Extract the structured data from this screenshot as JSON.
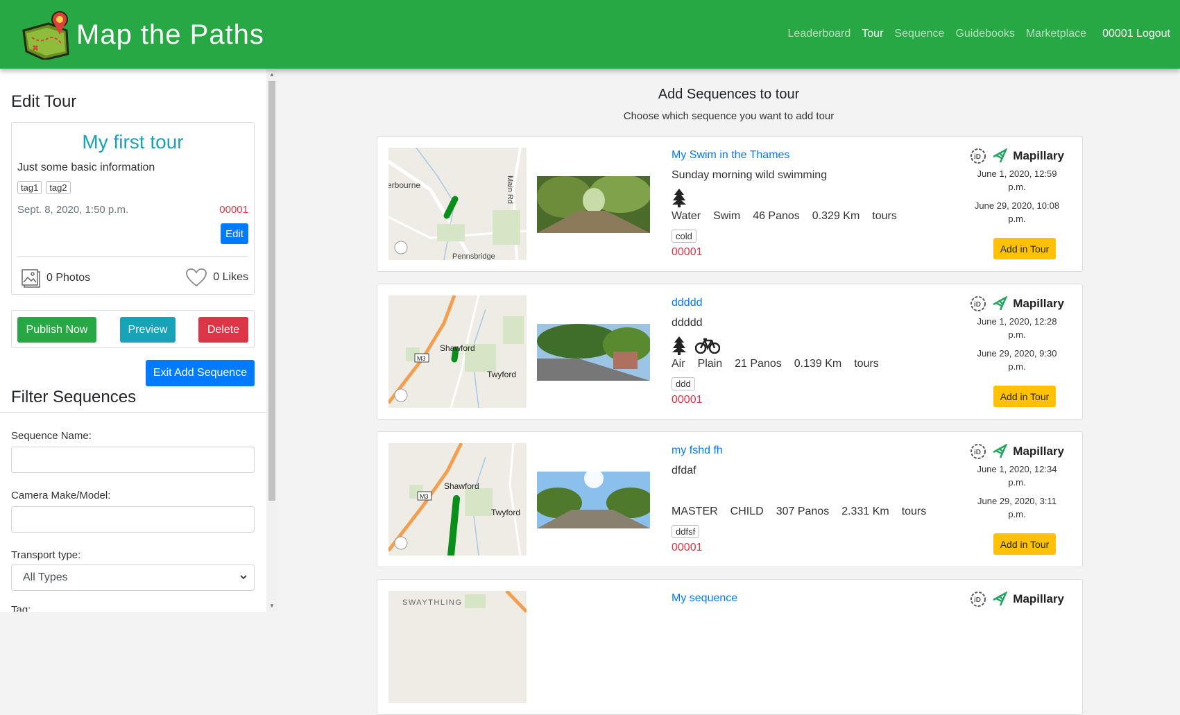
{
  "brand": {
    "name": "Map the Paths"
  },
  "nav": {
    "links": [
      {
        "label": "Leaderboard",
        "active": false
      },
      {
        "label": "Tour",
        "active": true
      },
      {
        "label": "Sequence",
        "active": false
      },
      {
        "label": "Guidebooks",
        "active": false
      },
      {
        "label": "Marketplace",
        "active": false
      }
    ],
    "user_logout": "00001 Logout"
  },
  "sidebar": {
    "title": "Edit Tour",
    "tour": {
      "name": "My first tour",
      "description": "Just some basic information",
      "tags": [
        "tag1",
        "tag2"
      ],
      "date": "Sept. 8, 2020, 1:50 p.m.",
      "user": "00001",
      "edit_label": "Edit",
      "photos": "0 Photos",
      "likes": "0 Likes"
    },
    "actions": {
      "publish": "Publish Now",
      "preview": "Preview",
      "delete": "Delete"
    },
    "exit_label": "Exit Add Sequence",
    "filter": {
      "title": "Filter Sequences",
      "sequence_name_label": "Sequence Name:",
      "sequence_name_value": "",
      "camera_label": "Camera Make/Model:",
      "camera_value": "",
      "transport_label": "Transport type:",
      "transport_value": "All Types",
      "tag_label": "Tag:"
    }
  },
  "main": {
    "title": "Add Sequences to tour",
    "subtitle": "Choose which sequence you want to add tour",
    "add_label": "Add in Tour",
    "mapillary_label": "Mapillary",
    "sequences": [
      {
        "title": "My Swim in the Thames",
        "description": "Sunday morning wild swimming",
        "icons": [
          "tree-icon"
        ],
        "stats": [
          "Water",
          "Swim",
          "46 Panos",
          "0.329 Km",
          "tours"
        ],
        "tag": "cold",
        "user": "00001",
        "captured": "June 1, 2020, 12:59 p.m.",
        "uploaded": "June 29, 2020, 10:08 p.m.",
        "map_labels": [
          "erbourne",
          "Main Rd",
          "Pennsbridge"
        ]
      },
      {
        "title": "ddddd",
        "description": "ddddd",
        "icons": [
          "tree-icon",
          "bicycle-icon"
        ],
        "stats": [
          "Air",
          "Plain",
          "21 Panos",
          "0.139 Km",
          "tours"
        ],
        "tag": "ddd",
        "user": "00001",
        "captured": "June 1, 2020, 12:28 p.m.",
        "uploaded": "June 29, 2020, 9:30 p.m.",
        "map_labels": [
          "Shawford",
          "Twyford",
          "M3"
        ]
      },
      {
        "title": "my fshd fh",
        "description": "dfdaf",
        "icons": [],
        "stats": [
          "MASTER",
          "CHILD",
          "307 Panos",
          "2.331 Km",
          "tours"
        ],
        "tag": "ddfsf",
        "user": "00001",
        "captured": "June 1, 2020, 12:34 p.m.",
        "uploaded": "June 29, 2020, 3:11 p.m.",
        "map_labels": [
          "Shawford",
          "Twyford",
          "M3"
        ]
      },
      {
        "title": "My sequence",
        "map_labels": [
          "SWAYTHLING"
        ]
      }
    ]
  },
  "colors": {
    "nav": "#28a745",
    "primary": "#007bff",
    "info": "#17a2b8",
    "danger": "#dc3545",
    "warning": "#ffc107"
  }
}
